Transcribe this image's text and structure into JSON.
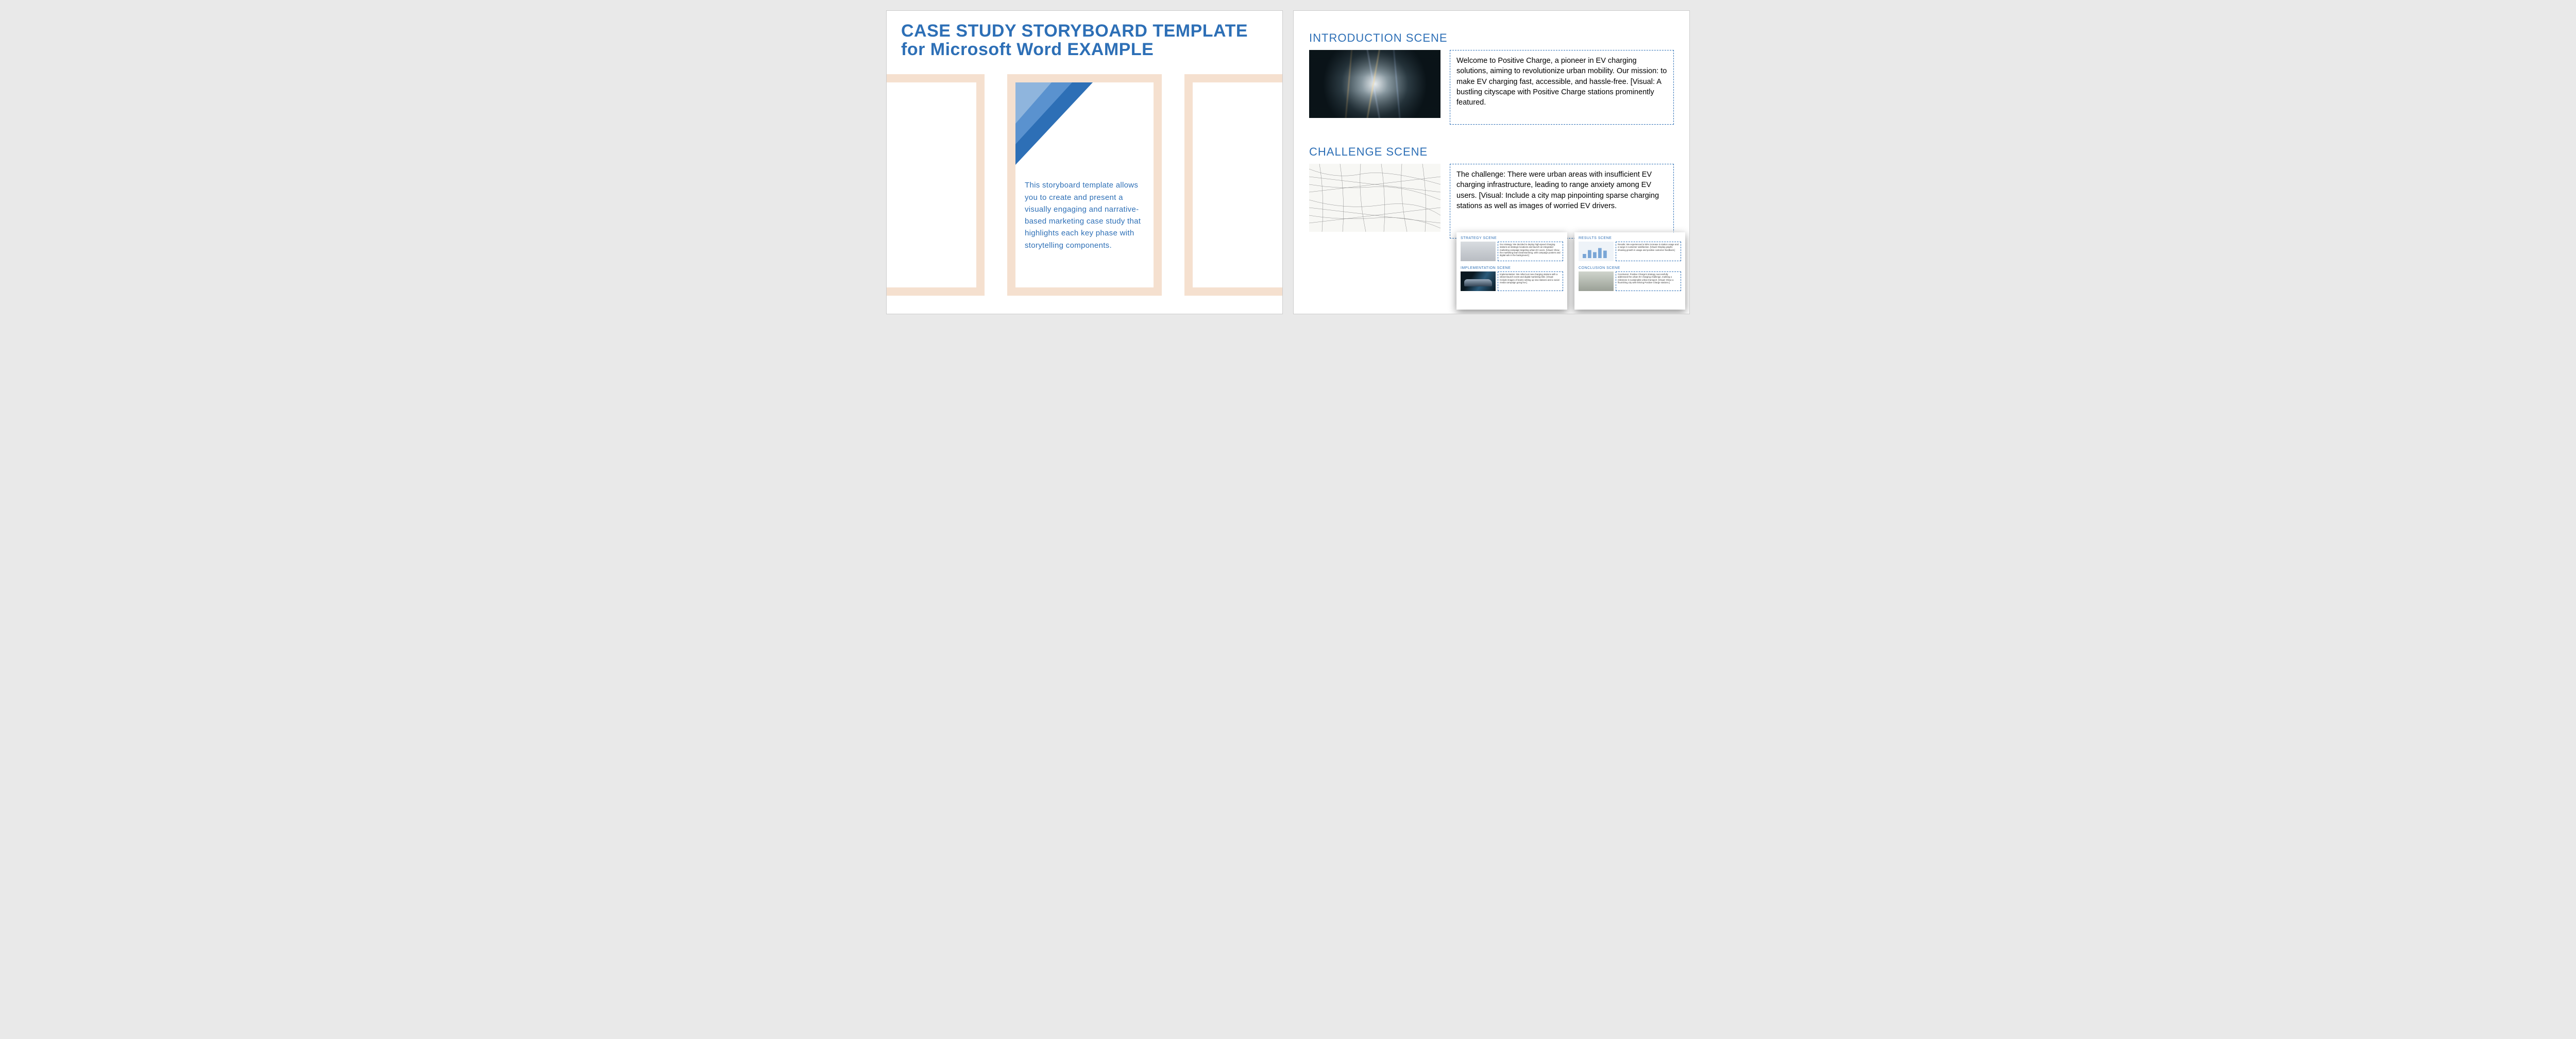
{
  "page1": {
    "title_line1": "CASE STUDY STORYBOARD TEMPLATE",
    "title_line2": "for Microsoft Word EXAMPLE",
    "center_text": "This storyboard template allows you to create and present a visually engaging and narrative-based marketing case study that highlights each key phase with storytelling components."
  },
  "page2": {
    "intro": {
      "heading": "INTRODUCTION SCENE",
      "text": "Welcome to Positive Charge, a pioneer in EV charging solutions, aiming to revolutionize urban mobility. Our mission: to make EV charging fast, accessible, and hassle-free. [Visual: A bustling cityscape with Positive Charge stations prominently featured."
    },
    "challenge": {
      "heading": "CHALLENGE SCENE",
      "text": "The challenge: There were urban areas with insufficient EV charging infrastructure, leading to range anxiety among EV users. [Visual: Include a city map pinpointing sparse charging stations as well as images of worried EV drivers."
    }
  },
  "mini": {
    "pageA": {
      "scene1": {
        "heading": "STRATEGY SCENE",
        "text": "Our strategy: We decided to deploy high-speed charging stations at strategic locations and launch an integrated marketing campaign targeting urban EV users. [Visual: Show the marketing team brainstorming, with campaign posters and digital ads in the background.]"
      },
      "scene2": {
        "heading": "IMPLEMENTATION SCENE",
        "text": "Implementation: We rolled out new charging stations with a vibrant launch event and digital marketing blitz. [Visual: Include images of teams setting up new stations and a social media campaign going live.]"
      }
    },
    "pageB": {
      "scene1": {
        "heading": "RESULTS SCENE",
        "text": "Results: We experienced a 50% increase in station usage and a surge in customer satisfaction. [Visual: Display graphs showing growth in usage and positive customer feedback.]"
      },
      "scene2": {
        "heading": "CONCLUSION SCENE",
        "text": "Conclusion: Positive Charge's strategy successfully addressed the urban EV charging challenge, marking a milestone in sustainable urban transport. [Visual: Show a flourishing city with thriving Positive Charge stations.]"
      }
    }
  }
}
